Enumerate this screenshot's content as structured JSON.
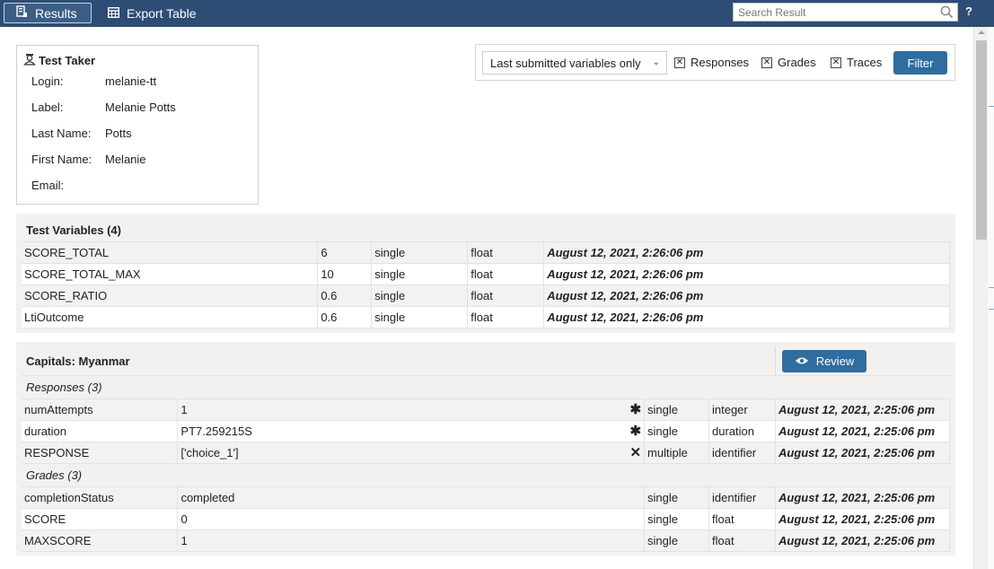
{
  "toolbar": {
    "results_label": "Results",
    "export_label": "Export Table",
    "search_placeholder": "Search Result",
    "help_label": "?"
  },
  "test_taker": {
    "title": "Test Taker",
    "rows": [
      {
        "key": "Login:",
        "value": "melanie-tt"
      },
      {
        "key": "Label:",
        "value": "Melanie Potts"
      },
      {
        "key": "Last Name:",
        "value": "Potts"
      },
      {
        "key": "First Name:",
        "value": "Melanie"
      },
      {
        "key": "Email:",
        "value": ""
      }
    ]
  },
  "filter": {
    "select_value": "Last submitted variables only",
    "responses_label": "Responses",
    "grades_label": "Grades",
    "traces_label": "Traces",
    "responses_checked": true,
    "grades_checked": true,
    "traces_checked": true,
    "button_label": "Filter"
  },
  "test_variables": {
    "title": "Test Variables (4)",
    "rows": [
      [
        "SCORE_TOTAL",
        "6",
        "single",
        "float",
        "August 12, 2021, 2:26:06 pm"
      ],
      [
        "SCORE_TOTAL_MAX",
        "10",
        "single",
        "float",
        "August 12, 2021, 2:26:06 pm"
      ],
      [
        "SCORE_RATIO",
        "0.6",
        "single",
        "float",
        "August 12, 2021, 2:26:06 pm"
      ],
      [
        "LtiOutcome",
        "0.6",
        "single",
        "float",
        "August 12, 2021, 2:26:06 pm"
      ]
    ]
  },
  "item": {
    "title": "Capitals: Myanmar",
    "review_label": "Review",
    "responses_title": "Responses (3)",
    "responses": [
      [
        "numAttempts",
        "1",
        "✱",
        "single",
        "integer",
        "August 12, 2021, 2:25:06 pm"
      ],
      [
        "duration",
        "PT7.259215S",
        "✱",
        "single",
        "duration",
        "August 12, 2021, 2:25:06 pm"
      ],
      [
        "RESPONSE",
        "['choice_1']",
        "✕",
        "multiple",
        "identifier",
        "August 12, 2021, 2:25:06 pm"
      ]
    ],
    "grades_title": "Grades (3)",
    "grades": [
      [
        "completionStatus",
        "completed",
        "",
        "single",
        "identifier",
        "August 12, 2021, 2:25:06 pm"
      ],
      [
        "SCORE",
        "0",
        "",
        "single",
        "float",
        "August 12, 2021, 2:25:06 pm"
      ],
      [
        "MAXSCORE",
        "1",
        "",
        "single",
        "float",
        "August 12, 2021, 2:25:06 pm"
      ]
    ]
  }
}
